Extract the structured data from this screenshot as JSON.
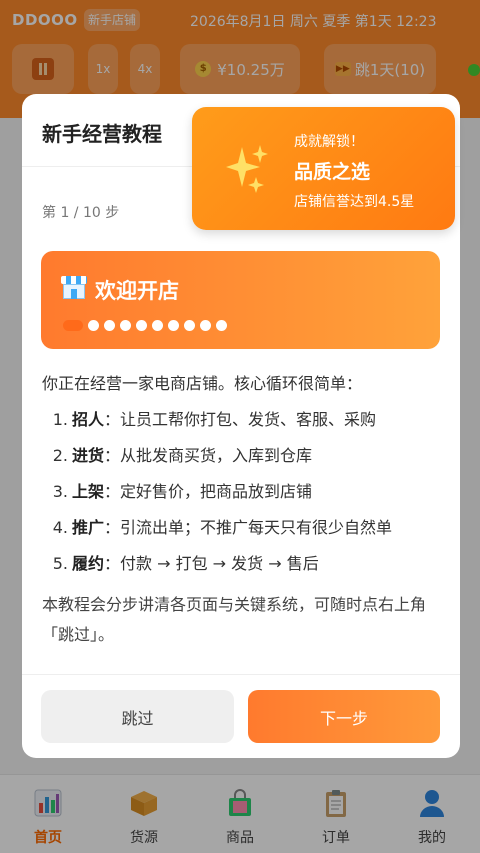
{
  "status": {
    "logo": "DDOOO",
    "shop_name": "新手店铺",
    "datetime": "2026年8月1日 周六 夏季 第1天 12:23"
  },
  "controls": {
    "speed_1x": "1x",
    "speed_4x": "4x",
    "money": "¥10.25万",
    "skip_day": "跳1天(10)"
  },
  "bottom_nav": [
    {
      "label": "首页",
      "icon": "chart-icon",
      "active": true
    },
    {
      "label": "货源",
      "icon": "box-icon",
      "active": false
    },
    {
      "label": "商品",
      "icon": "shopping-bag-icon",
      "active": false
    },
    {
      "label": "订单",
      "icon": "clipboard-icon",
      "active": false
    },
    {
      "label": "我的",
      "icon": "user-icon",
      "active": false
    }
  ],
  "modal": {
    "title": "新手经营教程",
    "step_counter": "第 1 / 10 步",
    "banner_title": "欢迎开店",
    "total_steps": 10,
    "current_step": 1,
    "intro": "你正在经营一家电商店铺。核心循环很简单：",
    "steps": [
      {
        "num": "1.",
        "keyword": "招人",
        "text": "：让员工帮你打包、发货、客服、采购"
      },
      {
        "num": "2.",
        "keyword": "进货",
        "text": "：从批发商买货，入库到仓库"
      },
      {
        "num": "3.",
        "keyword": "上架",
        "text": "：定好售价，把商品放到店铺"
      },
      {
        "num": "4.",
        "keyword": "推广",
        "text": "：引流出单；不推广每天只有很少自然单"
      },
      {
        "num": "5.",
        "keyword": "履约",
        "text": "：付款 → 打包 → 发货 → 售后"
      }
    ],
    "closing": "本教程会分步讲清各页面与关键系统，可随时点右上角「跳过」。",
    "skip_label": "跳过",
    "next_label": "下一步"
  },
  "toast": {
    "caption": "成就解锁！",
    "title": "品质之选",
    "description": "店铺信誉达到4.5星"
  },
  "colors": {
    "accent": "#ff7a2e",
    "top_bar": "#ff8a2b",
    "toast": "#ff8c15",
    "active_nav": "#ff6a00"
  }
}
